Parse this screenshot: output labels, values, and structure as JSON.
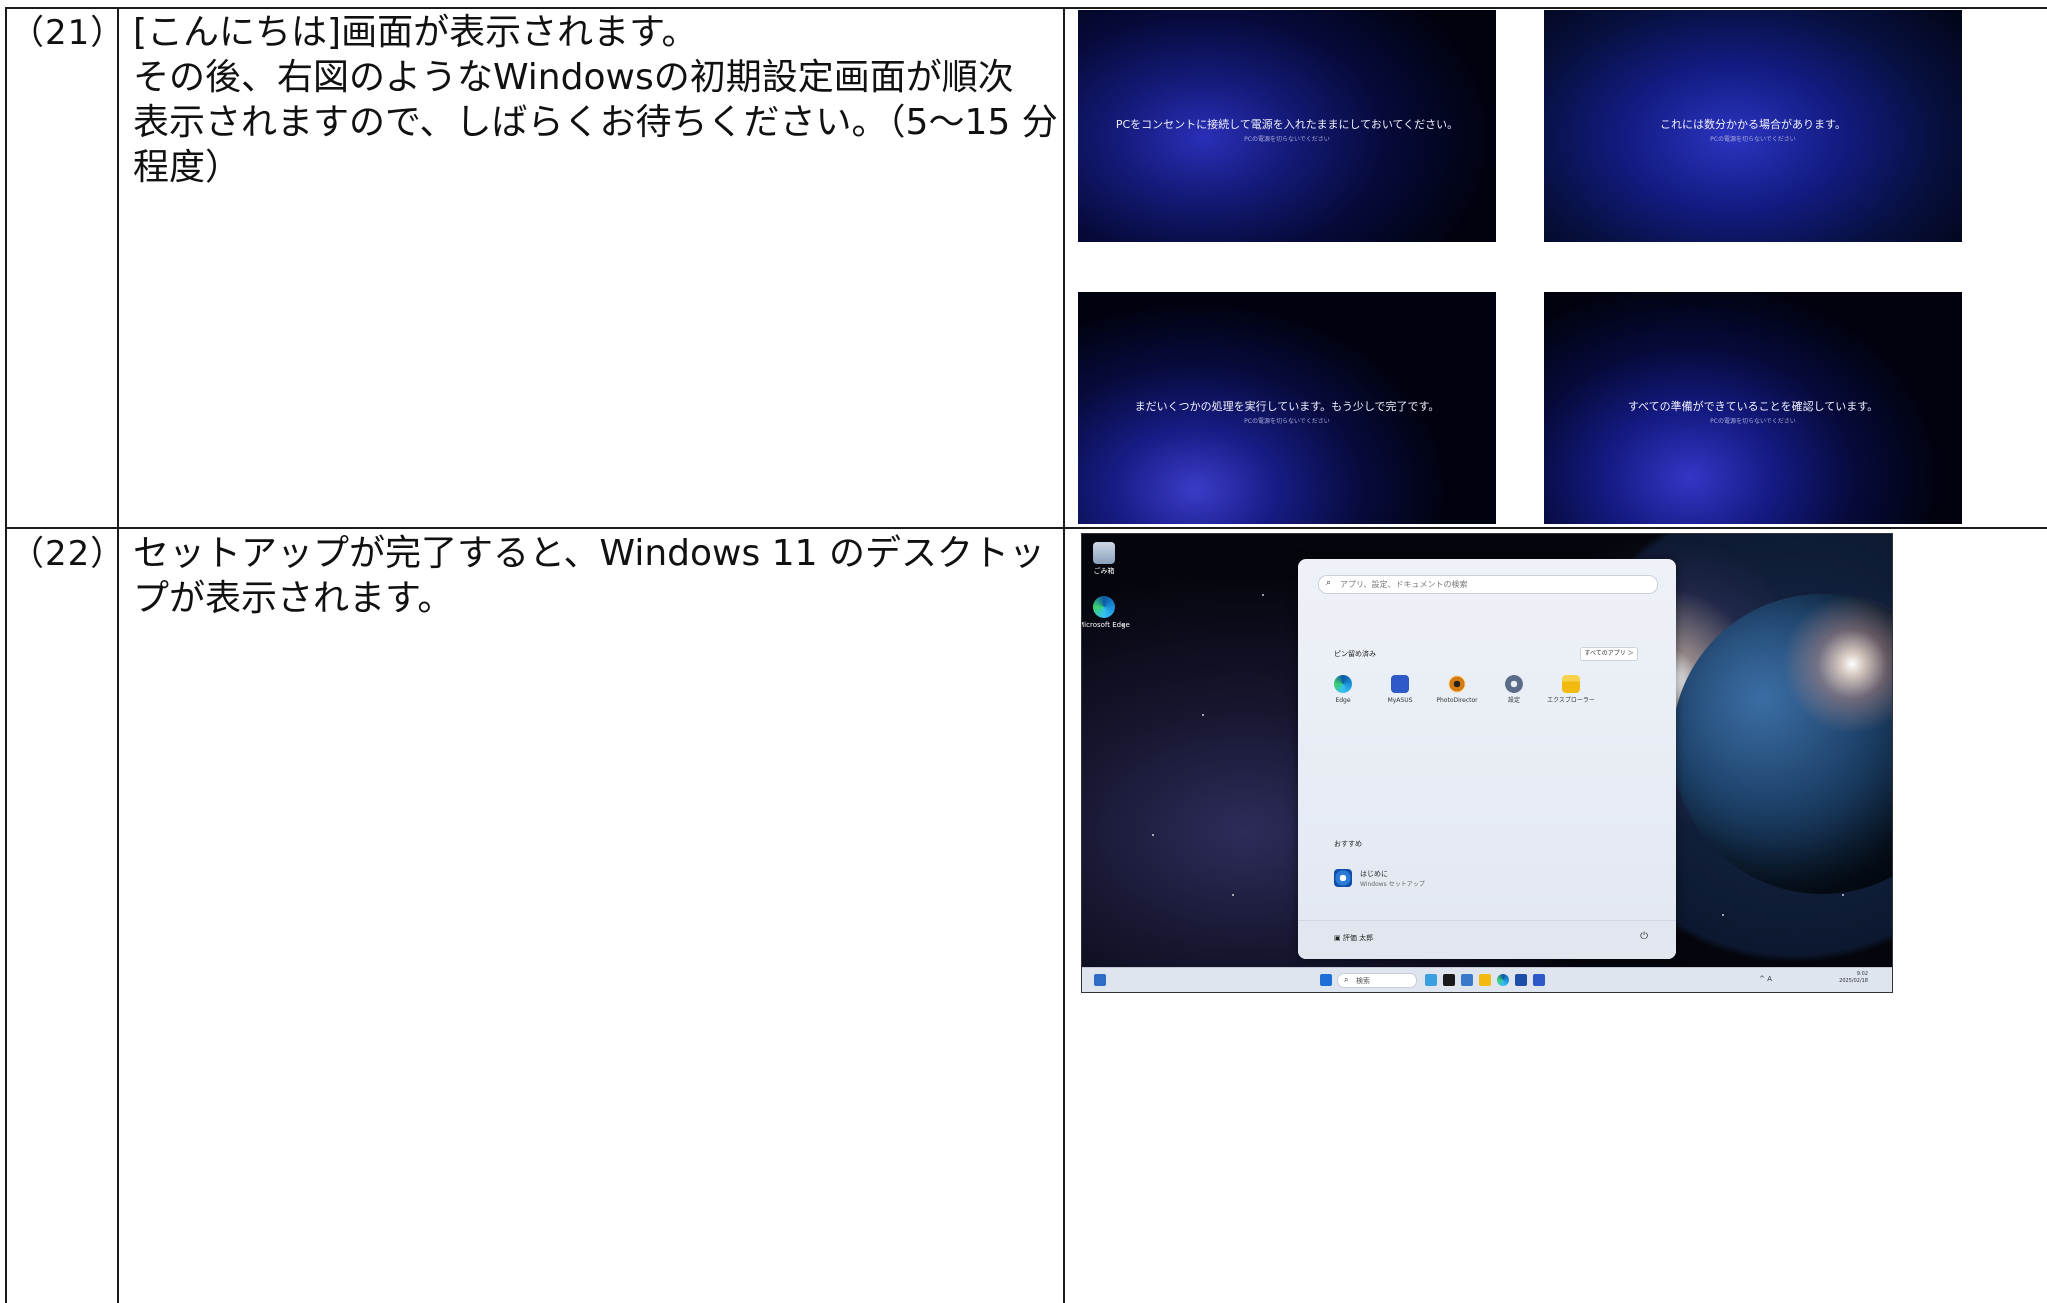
{
  "steps": [
    {
      "number": "（21）",
      "lines": [
        "[こんにちは]画面が表示されます。",
        "その後、右図のようなWindowsの初期設定画面が順次",
        "表示されますので、しばらくお待ちください。（5〜15 分",
        "程度）"
      ],
      "screens": [
        {
          "message": "PCをコンセントに接続して電源を入れたままにしておいてください。",
          "sub": "PCの電源を切らないでください"
        },
        {
          "message": "これには数分かかる場合があります。",
          "sub": "PCの電源を切らないでください"
        },
        {
          "message": "まだいくつかの処理を実行しています。もう少しで完了です。",
          "sub": "PCの電源を切らないでください"
        },
        {
          "message": "すべての準備ができていることを確認しています。",
          "sub": "PCの電源を切らないでください"
        }
      ]
    },
    {
      "number": "（22）",
      "lines": [
        "セットアップが完了すると、Windows 11 のデスクトッ",
        "プが表示されます。"
      ],
      "desktop": {
        "icons": [
          {
            "label": "ごみ箱",
            "icon": "recycle-bin-icon"
          },
          {
            "label": "Microsoft Edge",
            "icon": "edge-icon"
          }
        ],
        "start_menu": {
          "search_placeholder": "アプリ、設定、ドキュメントの検索",
          "pinned_label": "ピン留め済み",
          "all_apps_label": "すべてのアプリ ＞",
          "pinned_apps": [
            {
              "label": "Edge",
              "icon": "edge-icon",
              "color": "#1b8fd8"
            },
            {
              "label": "MyASUS",
              "icon": "myasus-icon",
              "color": "#2f58c8"
            },
            {
              "label": "PhotoDirector",
              "icon": "photodirector-icon",
              "color": "#d37a10"
            },
            {
              "label": "設定",
              "icon": "settings-gear-icon",
              "color": "#5b6d86"
            },
            {
              "label": "エクスプローラー",
              "icon": "file-explorer-icon",
              "color": "#f2b90f"
            }
          ],
          "recommended_label": "おすすめ",
          "recommended_item": {
            "title": "はじめに",
            "subtitle": "Windows セットアップ"
          },
          "user_name": "評価 太郎",
          "power_symbol": "⏻"
        },
        "taskbar": {
          "search_label": "検索",
          "tray": "^  A",
          "time": "9:02",
          "date": "2025/02/18"
        }
      }
    }
  ]
}
